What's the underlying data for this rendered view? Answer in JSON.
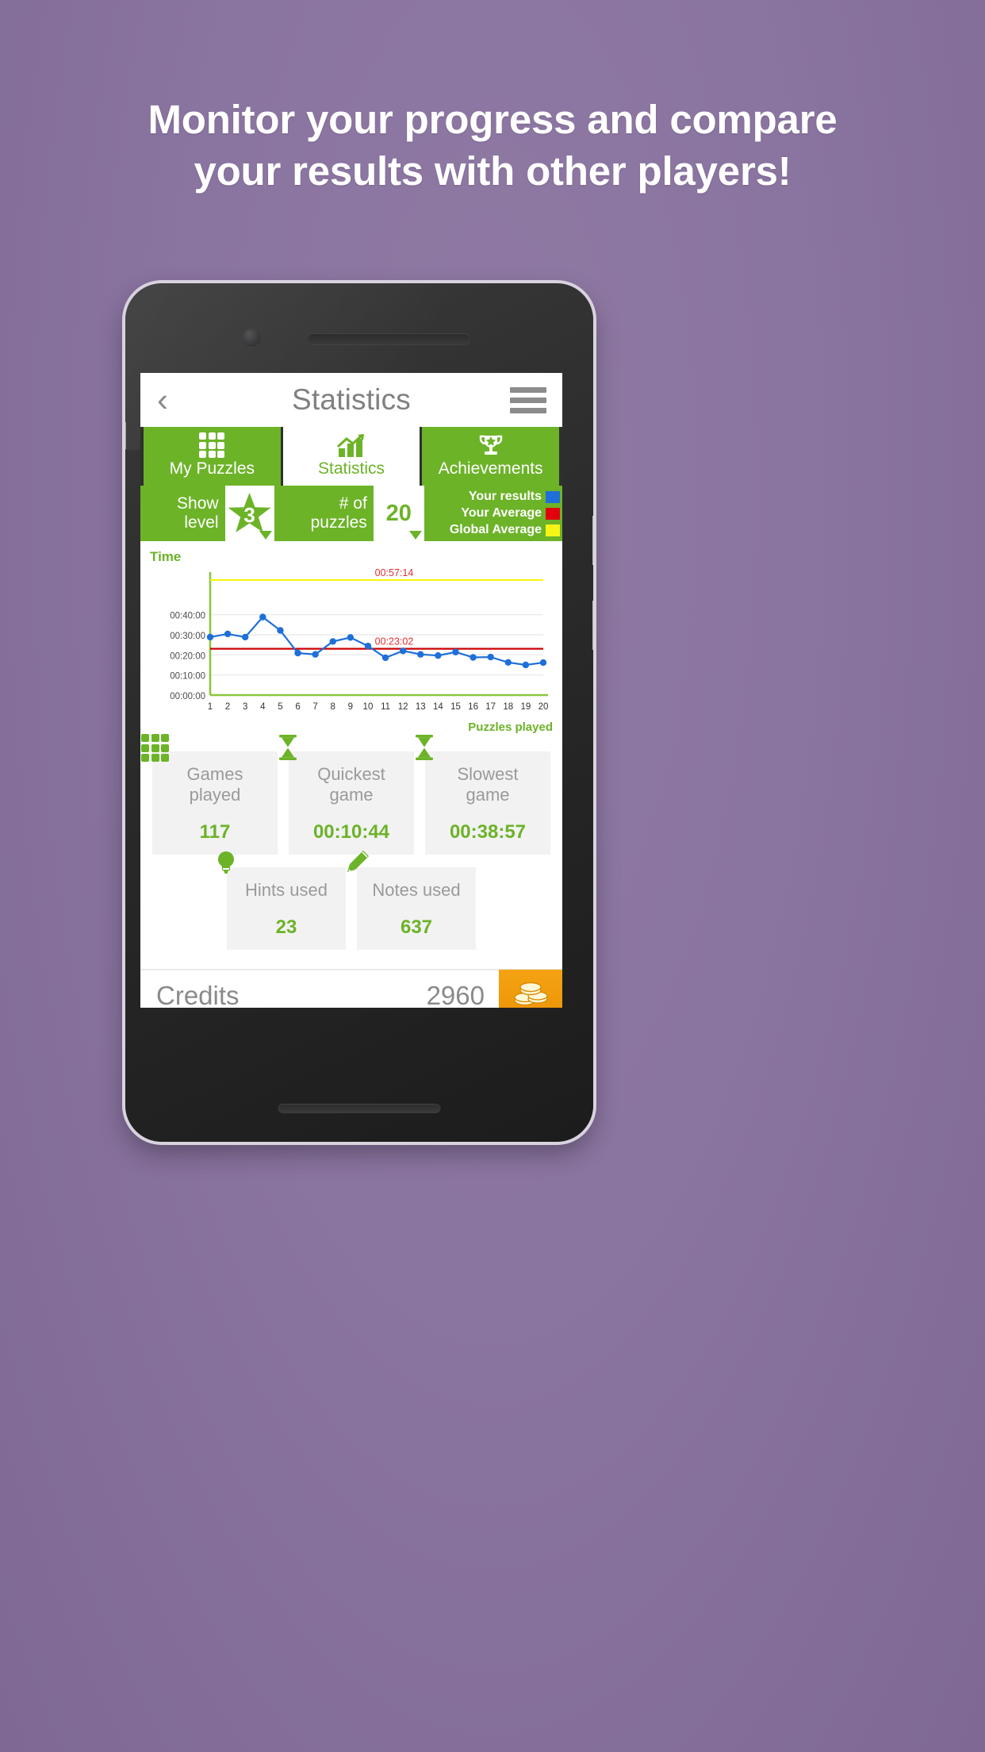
{
  "headline": {
    "line1": "Monitor your progress and compare",
    "line2": "your results with other players!"
  },
  "appbar": {
    "back_label": "‹",
    "title": "Statistics",
    "menu_label": "menu"
  },
  "tabs": [
    {
      "label": "My Puzzles",
      "icon": "grid-icon",
      "active": false
    },
    {
      "label": "Statistics",
      "icon": "bar-chart-icon",
      "active": true
    },
    {
      "label": "Achievements",
      "icon": "trophy-icon",
      "active": false
    }
  ],
  "filters": {
    "level_label_line1": "Show",
    "level_label_line2": "level",
    "level_value": "3",
    "puzzles_label_line1": "# of",
    "puzzles_label_line2": "puzzles",
    "puzzles_value": "20",
    "legend": [
      {
        "label": "Your results",
        "color": "#1e6fd9"
      },
      {
        "label": "Your Average",
        "color": "#e2000f"
      },
      {
        "label": "Global Average",
        "color": "#f5f516"
      }
    ]
  },
  "chart_data": {
    "type": "line",
    "title": "Time",
    "xlabel": "Puzzles played",
    "ylabel": "Time",
    "categories": [
      "1",
      "2",
      "3",
      "4",
      "5",
      "6",
      "7",
      "8",
      "9",
      "10",
      "11",
      "12",
      "13",
      "14",
      "15",
      "16",
      "17",
      "18",
      "19",
      "20"
    ],
    "ytick_labels": [
      "00:00:00",
      "00:10:00",
      "00:20:00",
      "00:30:00",
      "00:40:00"
    ],
    "ytick_values": [
      0,
      600,
      1200,
      1800,
      2400
    ],
    "ylim": [
      0,
      3600
    ],
    "grid": true,
    "legend_position": "top-right-external",
    "series": [
      {
        "name": "Your results",
        "color": "#1e6fd9",
        "values": [
          1730,
          1825,
          1730,
          2330,
          1930,
          1255,
          1215,
          1600,
          1720,
          1465,
          1115,
          1320,
          1215,
          1180,
          1285,
          1125,
          1135,
          975,
          900,
          970
        ]
      }
    ],
    "reference_lines": [
      {
        "name": "Global Average",
        "label": "00:57:14",
        "color": "#f5f516",
        "value": 3434
      },
      {
        "name": "Your Average",
        "label": "00:23:02",
        "color": "#cc0000",
        "value": 1382
      }
    ]
  },
  "stats": {
    "row1": [
      {
        "icon": "grid-icon",
        "title_line1": "Games",
        "title_line2": "played",
        "value": "117"
      },
      {
        "icon": "hourglass-icon",
        "title_line1": "Quickest",
        "title_line2": "game",
        "value": "00:10:44"
      },
      {
        "icon": "hourglass-icon",
        "title_line1": "Slowest",
        "title_line2": "game",
        "value": "00:38:57"
      }
    ],
    "row2": [
      {
        "icon": "lightbulb-icon",
        "title_line1": "Hints used",
        "title_line2": "",
        "value": "23"
      },
      {
        "icon": "pencil-icon",
        "title_line1": "Notes used",
        "title_line2": "",
        "value": "637"
      }
    ]
  },
  "credits": {
    "label": "Credits",
    "value": "2960",
    "coin_icon": "coins-icon"
  },
  "colors": {
    "brand_green": "#6cb328",
    "background_purple": "#8a74a0",
    "coin_orange": "#f0990a"
  }
}
